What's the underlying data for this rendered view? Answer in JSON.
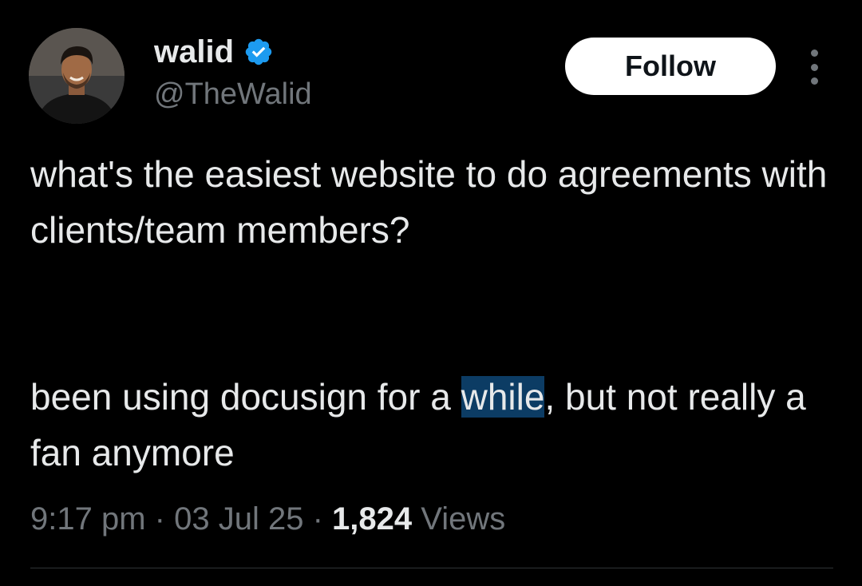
{
  "author": {
    "display_name": "walid",
    "handle": "@TheWalid",
    "verified": true,
    "verified_color": "#1d9bf0"
  },
  "actions": {
    "follow_label": "Follow",
    "more_icon": "more-vertical-icon"
  },
  "tweet": {
    "paragraph_1": "what's the easiest website to do agreements with clients/team members?",
    "paragraph_2_before": "been using docusign for a ",
    "paragraph_2_highlight": "while",
    "paragraph_2_after": ", but not really a fan anymore"
  },
  "meta": {
    "time": "9:17 pm",
    "date": "03 Jul 25",
    "separator": "·",
    "views_count": "1,824",
    "views_label": "Views"
  },
  "colors": {
    "background": "#000000",
    "text_primary": "#e7e9ea",
    "text_secondary": "#71767b",
    "selection_highlight": "#0c3c64",
    "divider": "#2f3336"
  }
}
